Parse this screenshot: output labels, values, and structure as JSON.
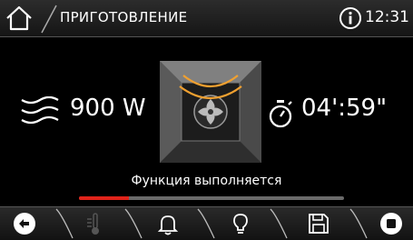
{
  "header": {
    "title": "ПРИГОТОВЛЕНИЕ",
    "time": "12:31",
    "home_icon": "home-icon",
    "info_icon": "info-icon"
  },
  "main": {
    "power": "900 W",
    "duration": "04':59\"",
    "status": "Функция выполняется",
    "progress": 0.19,
    "power_icon": "microwave-waves-icon",
    "timer_icon": "stopwatch-icon",
    "oven_icon": "oven-fan-icon"
  },
  "footer": {
    "buttons": [
      {
        "icon": "back-icon",
        "enabled": true
      },
      {
        "icon": "thermometer-icon",
        "enabled": false
      },
      {
        "icon": "bell-icon",
        "enabled": true
      },
      {
        "icon": "bulb-icon",
        "enabled": true
      },
      {
        "icon": "save-icon",
        "enabled": true
      },
      {
        "icon": "stop-icon",
        "enabled": true
      }
    ]
  },
  "colors": {
    "accent": "#e0231a",
    "oven_wave": "#f0a030",
    "background": "#000000"
  }
}
